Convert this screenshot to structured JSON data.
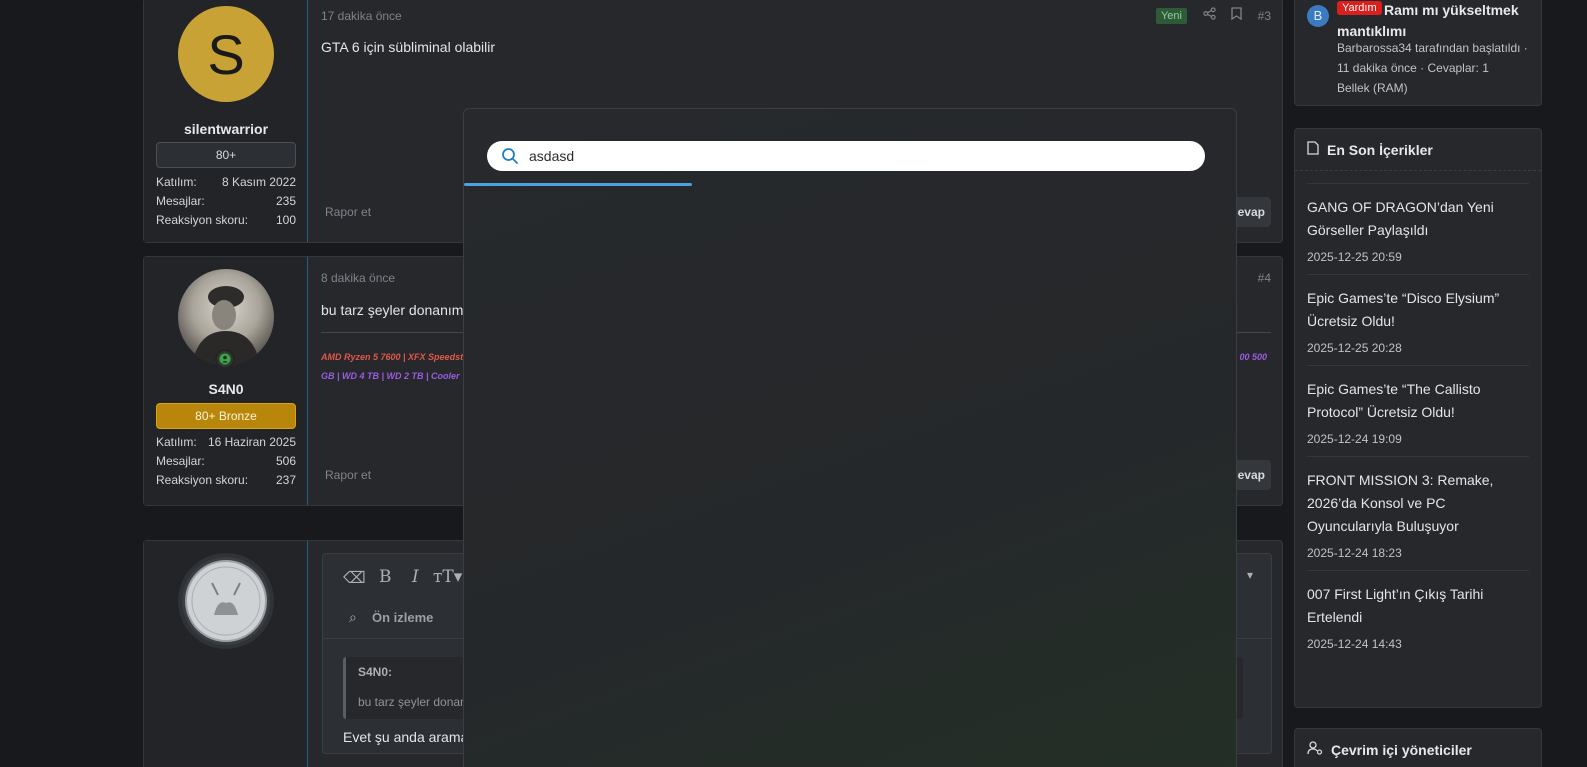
{
  "posts": [
    {
      "user": {
        "name": "silentwarrior",
        "avatar_letter": "S",
        "badge": "80+",
        "joined_label": "Katılım:",
        "joined": "8 Kasım 2022",
        "messages_label": "Mesajlar:",
        "messages": "235",
        "reaction_label": "Reaksiyon skoru:",
        "reaction": "100"
      },
      "time": "17 dakika önce",
      "new_label": "Yeni",
      "number": "#3",
      "message": "GTA 6 için sübliminal olabilir",
      "report": "Rapor et",
      "reply": "Cevap"
    },
    {
      "user": {
        "name": "S4N0",
        "badge": "80+ Bronze",
        "joined_label": "Katılım:",
        "joined": "16 Haziran 2025",
        "messages_label": "Mesajlar:",
        "messages": "506",
        "reaction_label": "Reaksiyon skoru:",
        "reaction": "237"
      },
      "time": "8 dakika önce",
      "number": "#4",
      "message": "bu tarz şeyler donanım",
      "signature_line1": "AMD Ryzen 5 7600 | XFX Speedst",
      "signature_line2": "GB | WD 4 TB | WD 2 TB | Cooler",
      "signature_right": "00 500",
      "report": "Rapor et",
      "reply": "Cevap"
    }
  ],
  "editor": {
    "preview_label": "Ön izleme",
    "quote_author": "S4N0:",
    "quote_text": "bu tarz şeyler donan",
    "draft_text": "Evet şu anda arama"
  },
  "sidebar": {
    "top_thread": {
      "avatar_letter": "B",
      "tag": "Yardım",
      "title": "Ramı mı yükseltmek mantıklımı",
      "meta1": "Barbarossa34 tarafından başlatıldı ·",
      "meta2": "11 dakika önce · Cevaplar: 1",
      "forum": "Bellek (RAM)"
    },
    "latest_title": "En Son İçerikler",
    "latest": [
      {
        "title": "GANG OF DRAGON’dan Yeni Görseller Paylaşıldı",
        "date": "2025-12-25 20:59"
      },
      {
        "title": "Epic Games’te “Disco Elysium” Ücretsiz Oldu!",
        "date": "2025-12-25 20:28"
      },
      {
        "title": "Epic Games’te “The Callisto Protocol” Ücretsiz Oldu!",
        "date": "2025-12-24 19:09"
      },
      {
        "title": "FRONT MISSION 3: Remake, 2026’da Konsol ve PC Oyuncularıyla Buluşuyor",
        "date": "2025-12-24 18:23"
      },
      {
        "title": "007 First Light’ın Çıkış Tarihi Ertelendi",
        "date": "2025-12-24 14:43"
      }
    ],
    "online_title": "Çevrim içi yöneticiler"
  },
  "search": {
    "value": "asdasd"
  },
  "colors": {
    "accent": "#4aa3e0",
    "bronze": "#b8860b",
    "tag_red": "#d9201f",
    "new_green": "#2f5a37"
  }
}
